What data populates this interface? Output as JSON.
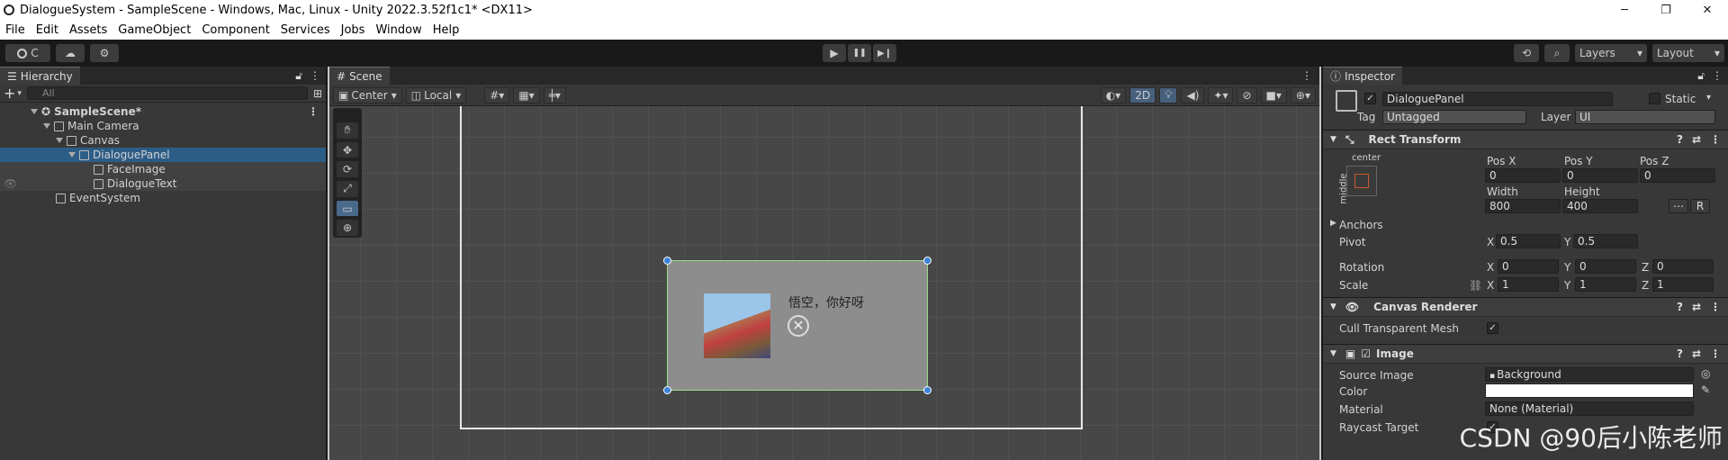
{
  "window": {
    "title": "DialogueSystem - SampleScene - Windows, Mac, Linux - Unity 2022.3.52f1c1* <DX11>",
    "min": "─",
    "max": "❐",
    "close": "✕"
  },
  "menu": [
    "File",
    "Edit",
    "Assets",
    "GameObject",
    "Component",
    "Services",
    "Jobs",
    "Window",
    "Help"
  ],
  "toolbar": {
    "account": "C",
    "cloud": "☁",
    "collab": "⚙",
    "play": "▶",
    "pause": "❚❚",
    "step": "▶❙",
    "history": "⟲",
    "search": "⌕",
    "layers": "Layers",
    "layout": "Layout"
  },
  "hierarchy": {
    "tab": "Hierarchy",
    "search_placeholder": "All",
    "add": "+",
    "items": [
      {
        "label": "SampleScene*",
        "indent": 0
      },
      {
        "label": "Main Camera",
        "indent": 1
      },
      {
        "label": "Canvas",
        "indent": 1
      },
      {
        "label": "DialoguePanel",
        "indent": 2
      },
      {
        "label": "FaceImage",
        "indent": 3
      },
      {
        "label": "DialogueText",
        "indent": 3
      },
      {
        "label": "EventSystem",
        "indent": 1
      }
    ]
  },
  "scene": {
    "tab": "Scene",
    "pivot": "Center",
    "space": "Local",
    "mode_2d": "2D",
    "dialogue_text": "悟空，你好呀"
  },
  "inspector": {
    "tab": "Inspector",
    "object_name": "DialoguePanel",
    "static": "Static",
    "tag_label": "Tag",
    "tag": "Untagged",
    "layer_label": "Layer",
    "layer": "UI",
    "rect": {
      "title": "Rect Transform",
      "anchor_h": "center",
      "anchor_v": "middle",
      "posx_l": "Pos X",
      "posy_l": "Pos Y",
      "posz_l": "Pos Z",
      "posx": "0",
      "posy": "0",
      "posz": "0",
      "w_l": "Width",
      "h_l": "Height",
      "w": "800",
      "h": "400",
      "anchors": "Anchors",
      "pivot": "Pivot",
      "pivx": "0.5",
      "pivy": "0.5",
      "rotation": "Rotation",
      "rx": "0",
      "ry": "0",
      "rz": "0",
      "scale": "Scale",
      "sx": "1",
      "sy": "1",
      "sz": "1",
      "xl": "X",
      "yl": "Y",
      "zl": "Z",
      "r_btn": "R"
    },
    "canvas_renderer": {
      "title": "Canvas Renderer",
      "cull": "Cull Transparent Mesh"
    },
    "image": {
      "title": "Image",
      "source_l": "Source Image",
      "source": "Background",
      "color_l": "Color",
      "material_l": "Material",
      "material": "None (Material)",
      "raycast_l": "Raycast Target"
    }
  },
  "watermark": "CSDN @90后小陈老师"
}
